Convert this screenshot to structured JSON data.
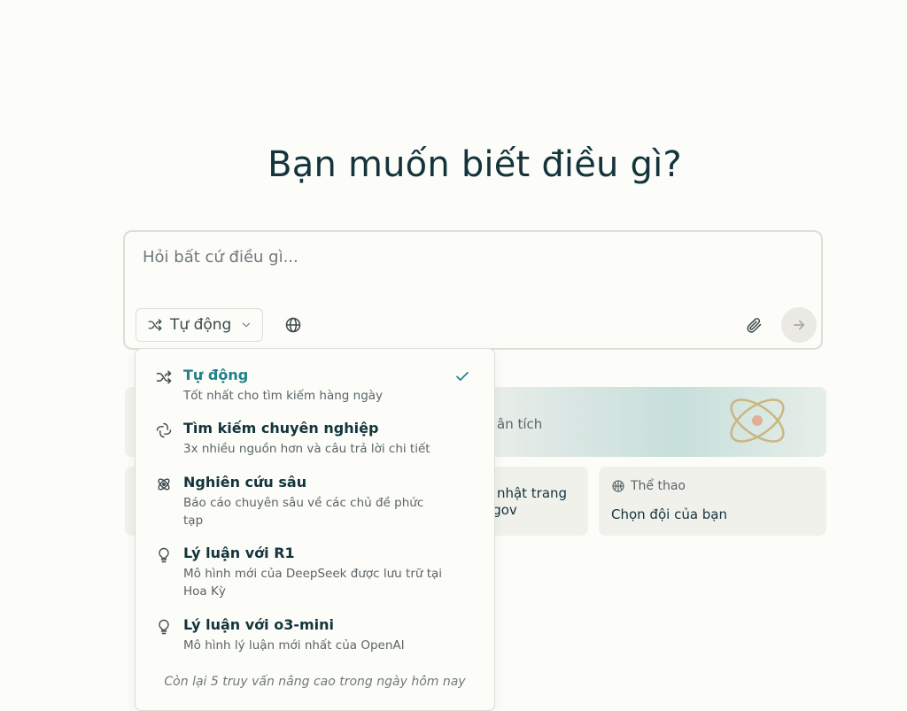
{
  "hero": {
    "title": "Bạn muốn biết điều gì?"
  },
  "search": {
    "placeholder": "Hỏi bất cứ điều gì...",
    "mode_label": "Tự động"
  },
  "cards": {
    "banner_text": "ân tích",
    "card_a_line1": "o nhật trang",
    "card_a_line2": "I.gov",
    "sports_tag": "Thể thao",
    "sports_text": "Chọn đội của bạn"
  },
  "dropdown": {
    "options": [
      {
        "label": "Tự động",
        "desc": "Tốt nhất cho tìm kiếm hàng ngày",
        "icon": "shuffle-icon",
        "selected": true
      },
      {
        "label": "Tìm kiếm chuyên nghiệp",
        "desc": "3x nhiều nguồn hơn và câu trả lời chi tiết",
        "icon": "pro-search-icon"
      },
      {
        "label": "Nghiên cứu sâu",
        "desc": "Báo cáo chuyên sâu về các chủ đề phức tạp",
        "icon": "atom-icon"
      },
      {
        "label": "Lý luận với R1",
        "desc": "Mô hình mới của DeepSeek được lưu trữ tại Hoa Kỳ",
        "icon": "lightbulb-icon"
      },
      {
        "label": "Lý luận với o3-mini",
        "desc": "Mô hình lý luận mới nhất của OpenAI",
        "icon": "lightbulb-icon"
      }
    ],
    "remaining_text": "Còn lại 5 truy vấn nâng cao trong ngày hôm nay"
  },
  "colors": {
    "accent": "#218089",
    "text": "#13343b",
    "background": "#fcfcf9"
  }
}
